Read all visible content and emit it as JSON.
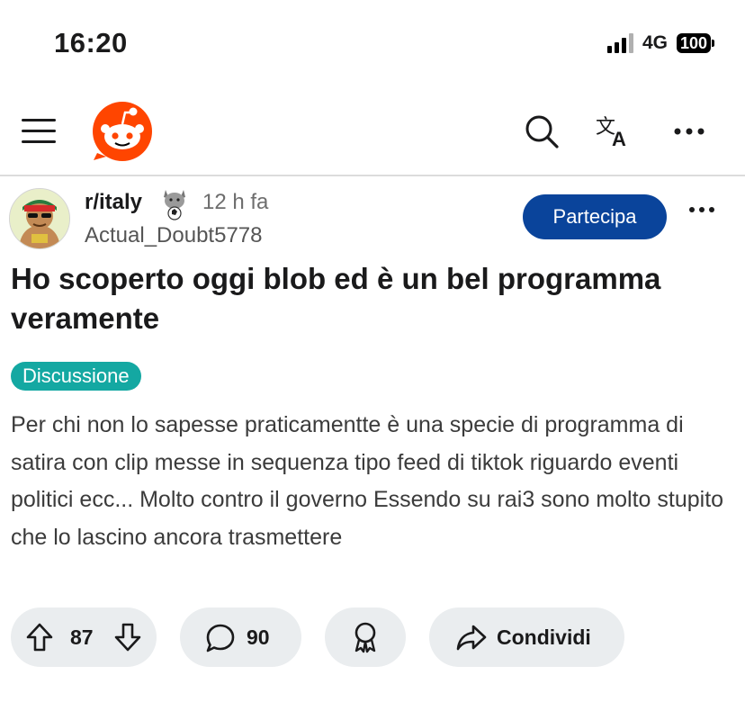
{
  "status_bar": {
    "time": "16:20",
    "network": "4G",
    "battery": "100"
  },
  "header": {
    "icons": [
      "menu-icon",
      "reddit-logo",
      "search-icon",
      "translate-icon",
      "more-icon"
    ]
  },
  "post": {
    "subreddit": "r/italy",
    "time_ago": "12 h fa",
    "author": "Actual_Doubt5778",
    "join_label": "Partecipa",
    "title": "Ho scoperto oggi blob ed è un bel programma veramente",
    "flair": "Discussione",
    "body": "Per chi non lo sapesse praticamentte è una specie di programma di satira con clip messe in sequenza tipo feed di tiktok riguardo eventi politici ecc... Molto contro il governo Essendo su rai3 sono molto stupito che lo lascino ancora trasmettere"
  },
  "actions": {
    "votes": "87",
    "comments": "90",
    "share_label": "Condividi"
  },
  "colors": {
    "reddit_orange": "#ff4500",
    "join_blue": "#0a449b",
    "flair_teal": "#14a8a2",
    "pill_bg": "#eaedef"
  }
}
